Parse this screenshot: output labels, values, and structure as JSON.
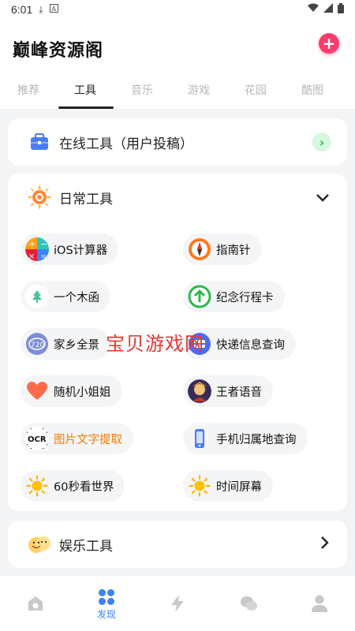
{
  "status_bar": {
    "time": "6:01"
  },
  "app": {
    "title": "巅峰资源阁",
    "add_icon": "plus-icon",
    "accent": "#ff3b6b"
  },
  "tabs": [
    {
      "label": "推荐",
      "active": false
    },
    {
      "label": "工具",
      "active": true
    },
    {
      "label": "音乐",
      "active": false
    },
    {
      "label": "游戏",
      "active": false
    },
    {
      "label": "花园",
      "active": false
    },
    {
      "label": "酷图",
      "active": false
    }
  ],
  "online_tools": {
    "label": "在线工具（用户投稿）",
    "icon": "toolbox-icon"
  },
  "daily_tools": {
    "label": "日常工具",
    "icon": "sun-gear-icon",
    "items": [
      {
        "label": "iOS计算器",
        "icon": "calculator-icon"
      },
      {
        "label": "指南针",
        "icon": "compass-icon"
      },
      {
        "label": "一个木函",
        "icon": "tree-icon"
      },
      {
        "label": "纪念行程卡",
        "icon": "arrow-up-circle-icon"
      },
      {
        "label": "家乡全景",
        "icon": "panorama-720-icon"
      },
      {
        "label": "快递信息查询",
        "icon": "delivery-icon"
      },
      {
        "label": "随机小姐姐",
        "icon": "heart-icon"
      },
      {
        "label": "王者语音",
        "icon": "hero-avatar-icon"
      },
      {
        "label": "图片文字提取",
        "icon": "ocr-icon"
      },
      {
        "label": "手机归属地查询",
        "icon": "phone-icon"
      },
      {
        "label": "60秒看世界",
        "icon": "sun-icon"
      },
      {
        "label": "时间屏幕",
        "icon": "sun-icon"
      }
    ]
  },
  "entertainment_tools": {
    "label": "娱乐工具",
    "icon": "emoji-icon"
  },
  "watermark": "宝贝游戏网",
  "bottom_nav": [
    {
      "label": "",
      "icon": "home-icon",
      "active": false
    },
    {
      "label": "发现",
      "icon": "grid-icon",
      "active": true
    },
    {
      "label": "",
      "icon": "lightning-icon",
      "active": false
    },
    {
      "label": "",
      "icon": "chat-icon",
      "active": false
    },
    {
      "label": "",
      "icon": "profile-icon",
      "active": false
    }
  ]
}
